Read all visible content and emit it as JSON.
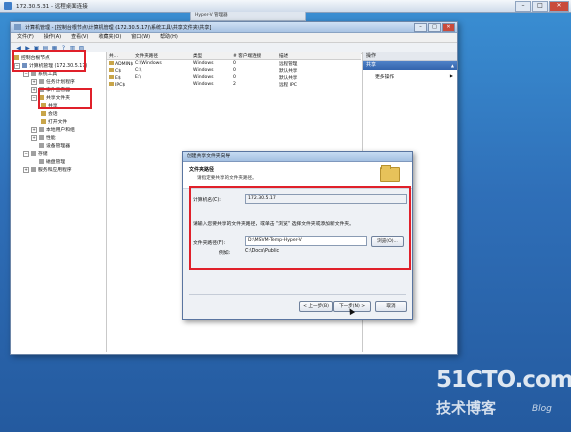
{
  "rdp": {
    "title": "172.30.5.31 - 远程桌面连接",
    "topbar": "Hyper-V 管理器"
  },
  "mmc": {
    "title": "计算机管理 - [控制台根节点\\计算机管理 (172.30.5.17)\\系统工具\\共享文件夹\\共享]",
    "menu": [
      "文件(F)",
      "操作(A)",
      "查看(V)",
      "收藏夹(O)",
      "窗口(W)",
      "帮助(H)"
    ],
    "tree": [
      {
        "label": "控制台根节点",
        "icon": "folder-icon"
      },
      {
        "label": "计算机管理 (172.30.5.17)",
        "icon": "computer-icon"
      },
      {
        "label": "系统工具",
        "icon": "tools-icon"
      },
      {
        "label": "任务计划程序",
        "icon": "clock-icon"
      },
      {
        "label": "事件查看器",
        "icon": "event-icon"
      },
      {
        "label": "共享文件夹",
        "icon": "share-folder-icon"
      },
      {
        "label": "共享",
        "icon": "folder-icon"
      },
      {
        "label": "会话",
        "icon": "folder-icon"
      },
      {
        "label": "打开文件",
        "icon": "folder-icon"
      },
      {
        "label": "本地用户和组",
        "icon": "users-icon"
      },
      {
        "label": "性能",
        "icon": "perf-icon"
      },
      {
        "label": "设备管理器",
        "icon": "device-icon"
      },
      {
        "label": "存储",
        "icon": "storage-icon"
      },
      {
        "label": "磁盘管理",
        "icon": "disk-icon"
      },
      {
        "label": "服务和应用程序",
        "icon": "services-icon"
      }
    ],
    "list": {
      "columns": [
        "共...",
        "文件夹路径",
        "类型",
        "# 客户端连接",
        "描述"
      ],
      "rows": [
        [
          "ADMIN$",
          "C:\\Windows",
          "Windows",
          "0",
          "远程管理"
        ],
        [
          "C$",
          "C:\\",
          "Windows",
          "0",
          "默认共享"
        ],
        [
          "E$",
          "E:\\",
          "Windows",
          "0",
          "默认共享"
        ],
        [
          "IPC$",
          "",
          "Windows",
          "2",
          "远程 IPC"
        ]
      ]
    },
    "actions": {
      "header": "操作",
      "selected": "共享",
      "more": "更多操作"
    }
  },
  "wizard": {
    "title": "创建共享文件夹向导",
    "heading": "文件夹路径",
    "subheading": "请指定要共享的文件夹路径。",
    "computer_label": "计算机名(C):",
    "computer_value": "172.30.5.17",
    "instruction": "请输入您要共享的文件夹路径，或单击 \"浏览\" 选择文件夹或添加新文件夹。",
    "path_label": "文件夹路径(F):",
    "path_value": "D:\\MSVM-Temp-Hyper-V",
    "browse": "浏览(O)...",
    "example_label": "例如:",
    "example_value": "C:\\Docs\\Public",
    "back": "< 上一步(B)",
    "next": "下一步(N) >",
    "cancel": "取消"
  },
  "watermark": {
    "line1": "51CTO.com",
    "line2": "技术博客",
    "line3": "Blog"
  }
}
